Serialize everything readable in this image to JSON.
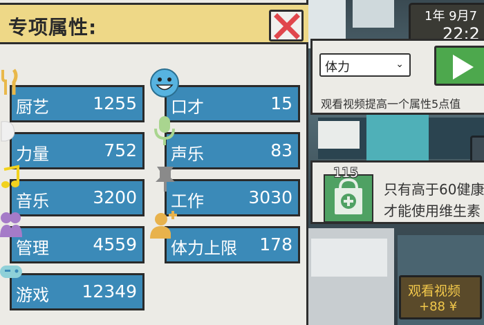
{
  "panel": {
    "title": "专项属性:",
    "stats_left": [
      {
        "label": "厨艺",
        "value": "1255",
        "icon": "fork-knife-icon"
      },
      {
        "label": "力量",
        "value": "752",
        "icon": "strength-icon"
      },
      {
        "label": "音乐",
        "value": "3200",
        "icon": "music-note-icon"
      },
      {
        "label": "管理",
        "value": "4559",
        "icon": "people-icon"
      },
      {
        "label": "游戏",
        "value": "12349",
        "icon": "gamepad-icon"
      }
    ],
    "stats_right": [
      {
        "label": "口才",
        "value": "15",
        "icon": "smiley-icon"
      },
      {
        "label": "声乐",
        "value": "83",
        "icon": "microphone-icon"
      },
      {
        "label": "工作",
        "value": "3030",
        "icon": "pushpin-icon"
      },
      {
        "label": "体力上限",
        "value": "178",
        "icon": "user-plus-icon"
      }
    ]
  },
  "date": {
    "date_text": "1年 9月7",
    "time_text": "22:2"
  },
  "watch": {
    "select_value": "体力",
    "desc": "观看视频提高一个属性5点值"
  },
  "medicine": {
    "count": "115",
    "line1": "只有高于60健康",
    "line2": "才能使用维生素"
  },
  "video_button": {
    "line1": "观看视频",
    "line2": "+88 ¥"
  },
  "colors": {
    "stat_blue": "#3b8ab8",
    "header_yellow": "#eed887",
    "play_green": "#4da84d",
    "close_red": "#e0474c"
  }
}
